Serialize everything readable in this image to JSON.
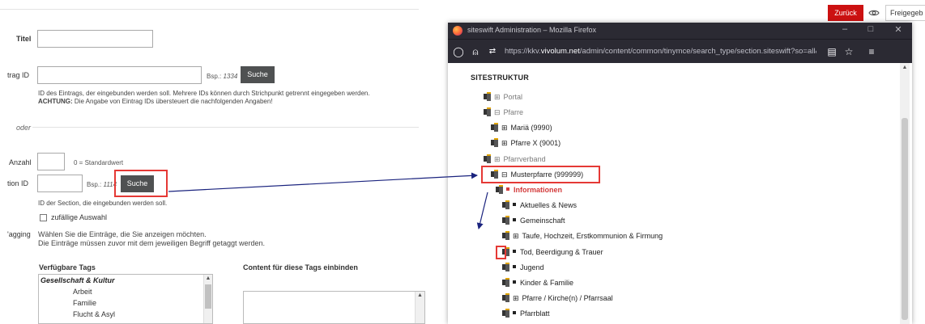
{
  "form": {
    "titel_label": "Titel",
    "eintrag_id_label": "trag ID",
    "eintrag_id_example_prefix": "Bsp.:",
    "eintrag_id_example_value": "1334",
    "suche_label": "Suche",
    "eintrag_desc_line1": "ID des Eintrags, der eingebunden werden soll. Mehrere IDs können durch Strichpunkt getrennt eingegeben werden.",
    "eintrag_desc_achtung": "ACHTUNG:",
    "eintrag_desc_line2": " Die Angabe von Eintrag IDs übersteuert die nachfolgenden Angaben!",
    "oder_label": "oder",
    "anzahl_label": "Anzahl",
    "anzahl_hint": "0 = Standardwert",
    "section_id_label": "tion ID",
    "section_example_prefix": "Bsp.:",
    "section_example_value": "1114",
    "section_suche_label": "Suche",
    "section_desc": "ID der Section, die eingebunden werden soll.",
    "random_label": "zufällige Auswahl",
    "tagging_label": "'agging",
    "tagging_desc_line1": "Wählen Sie die Einträge, die Sie anzeigen möchten.",
    "tagging_desc_line2": "Die Einträge müssen zuvor mit dem jeweiligen Begriff getaggt werden.",
    "available_tags_label": "Verfügbare Tags",
    "content_tags_label": "Content für diese Tags einbinden",
    "tag_group": "Gesellschaft & Kultur",
    "tags": [
      "Arbeit",
      "Familie",
      "Flucht & Asyl"
    ]
  },
  "topbar": {
    "zurueck_label": "Zurück",
    "freigabe_label": "Freigegeb"
  },
  "browser": {
    "window_title": "siteswift Administration – Mozilla Firefox",
    "url_prefix": "https://kkv.",
    "url_domain": "vivolum.net",
    "url_path": "/admin/content/common/tinymce/search_type/section.siteswift?so=all&do=",
    "sitestruktur_label": "SITESTRUKTUR",
    "tree": [
      {
        "label": "Portal",
        "toggle": "⊞",
        "style": "grey"
      },
      {
        "label": "Pfarre",
        "toggle": "⊟",
        "style": "grey"
      },
      {
        "label": "Mariä (9990)",
        "toggle": "⊞",
        "style": "normal"
      },
      {
        "label": "Pfarre X (9001)",
        "toggle": "⊞",
        "style": "normal"
      },
      {
        "label": "Pfarrverband",
        "toggle": "⊞",
        "style": "grey"
      },
      {
        "label": "Musterpfarre (999999)",
        "toggle": "⊟",
        "style": "normal"
      },
      {
        "label": "Informationen",
        "toggle": "",
        "style": "red"
      },
      {
        "label": "Aktuelles & News",
        "toggle": "",
        "style": "normal"
      },
      {
        "label": "Gemeinschaft",
        "toggle": "",
        "style": "normal"
      },
      {
        "label": "Taufe, Hochzeit, Erstkommunion & Firmung",
        "toggle": "⊞",
        "style": "normal"
      },
      {
        "label": "Tod, Beerdigung & Trauer",
        "toggle": "",
        "style": "normal"
      },
      {
        "label": "Jugend",
        "toggle": "",
        "style": "normal"
      },
      {
        "label": "Kinder & Familie",
        "toggle": "",
        "style": "normal"
      },
      {
        "label": "Pfarre / Kirche(n) / Pfarrsaal",
        "toggle": "⊞",
        "style": "normal"
      },
      {
        "label": "Pfarrblatt",
        "toggle": "",
        "style": "normal"
      }
    ]
  },
  "colors": {
    "accent_red": "#cc1111",
    "highlight": "#e53935",
    "arrow": "#1a237e"
  }
}
